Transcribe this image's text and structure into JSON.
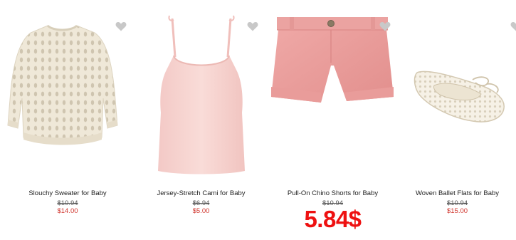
{
  "products": [
    {
      "name": "Slouchy Sweater for Baby",
      "old_price": "$10.94",
      "sale_price": "$14.00",
      "image_icon": "sweater-icon",
      "favorite_icon": "heart-icon"
    },
    {
      "name": "Jersey-Stretch Cami for Baby",
      "old_price": "$6.94",
      "sale_price": "$5.00",
      "image_icon": "cami-top-icon",
      "favorite_icon": "heart-icon"
    },
    {
      "name": "Pull-On Chino Shorts for Baby",
      "old_price": "$10.94",
      "promo_price": "5.84$",
      "image_icon": "shorts-icon",
      "favorite_icon": "heart-icon"
    },
    {
      "name": "Woven Ballet Flats for Baby",
      "old_price": "$10.94",
      "sale_price": "$15.00",
      "image_icon": "ballet-flat-icon",
      "favorite_icon": "heart-icon"
    }
  ],
  "colors": {
    "sale": "#d0342c",
    "promo": "#ee1111",
    "heart": "#c8c8c8",
    "text": "#222222"
  }
}
